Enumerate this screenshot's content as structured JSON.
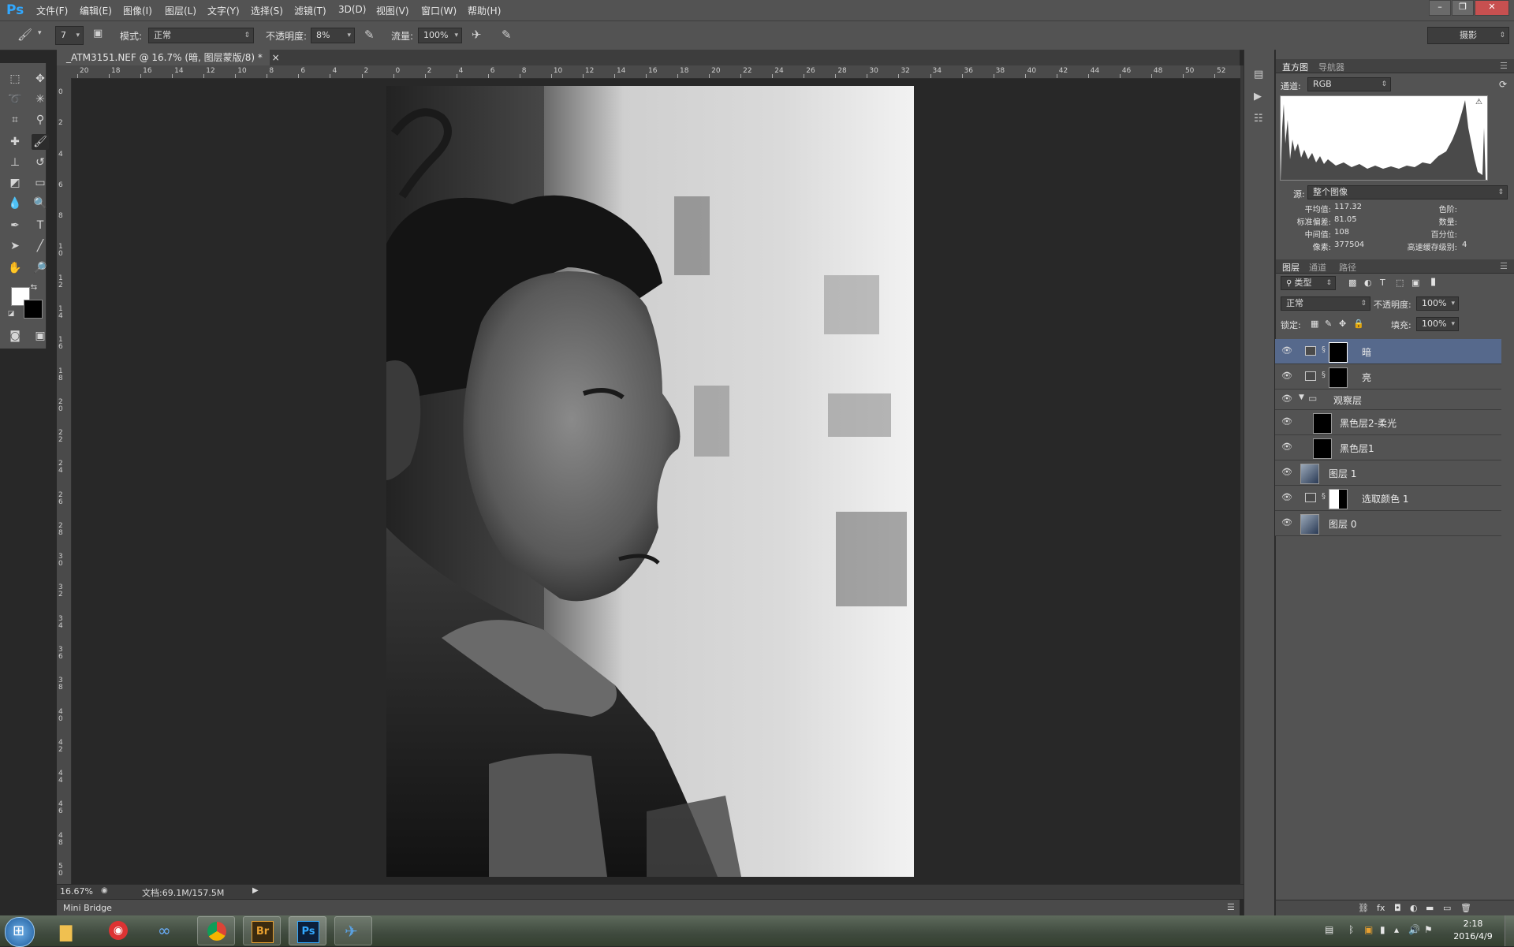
{
  "app": {
    "logo": "Ps"
  },
  "menu": [
    "文件(F)",
    "编辑(E)",
    "图像(I)",
    "图层(L)",
    "文字(Y)",
    "选择(S)",
    "滤镜(T)",
    "3D(D)",
    "视图(V)",
    "窗口(W)",
    "帮助(H)"
  ],
  "window_controls": {
    "minimize": "–",
    "restore": "❐",
    "close": "✕"
  },
  "options": {
    "brush_size": "7",
    "mode_label": "模式:",
    "mode_value": "正常",
    "opacity_label": "不透明度:",
    "opacity_value": "8%",
    "flow_label": "流量:",
    "flow_value": "100%",
    "workspace": "摄影"
  },
  "document": {
    "tab_title": "_ATM3151.NEF @ 16.7% (暗, 图层蒙版/8) *",
    "tab_close": "×",
    "zoom": "16.67%",
    "doc_size": "文档:69.1M/157.5M",
    "mini_bridge": "Mini Bridge",
    "h_ruler_ticks": [
      "20",
      "18",
      "16",
      "14",
      "12",
      "10",
      "8",
      "6",
      "4",
      "2",
      "0",
      "2",
      "4",
      "6",
      "8",
      "10",
      "12",
      "14",
      "16",
      "18",
      "20",
      "22",
      "24",
      "26",
      "28",
      "30",
      "32",
      "34",
      "36",
      "38",
      "40",
      "42",
      "44",
      "46",
      "48",
      "50",
      "52"
    ],
    "v_ruler_ticks": [
      "0",
      "2",
      "4",
      "6",
      "8",
      "10",
      "12",
      "14",
      "16",
      "18",
      "20",
      "22",
      "24",
      "26",
      "28",
      "30",
      "32",
      "34",
      "36",
      "38",
      "40",
      "42",
      "44",
      "46",
      "48",
      "50"
    ]
  },
  "histogram": {
    "tabs": [
      "直方图",
      "导航器"
    ],
    "channel_label": "通道:",
    "channel_value": "RGB",
    "source_label": "源:",
    "source_value": "整个图像",
    "stats": {
      "mean_label": "平均值:",
      "mean_value": "117.32",
      "stddev_label": "标准偏差:",
      "stddev_value": "81.05",
      "median_label": "中间值:",
      "median_value": "108",
      "pixels_label": "像素:",
      "pixels_value": "377504",
      "level_label": "色阶:",
      "count_label": "数量:",
      "percentile_label": "百分位:",
      "cache_label": "高速缓存级别:",
      "cache_value": "4"
    }
  },
  "layers_panel": {
    "tabs": [
      "图层",
      "通道",
      "路径"
    ],
    "filter_value": "类型",
    "blend_mode": "正常",
    "opacity_label": "不透明度:",
    "opacity_value": "100%",
    "lock_label": "锁定:",
    "fill_label": "填充:",
    "fill_value": "100%",
    "layers": [
      {
        "name": "暗",
        "kind": "curves-mask",
        "selected": true
      },
      {
        "name": "亮",
        "kind": "curves-mask",
        "selected": false
      },
      {
        "name": "观察层",
        "kind": "group",
        "selected": false
      },
      {
        "name": "黑色层2-柔光",
        "kind": "fill",
        "selected": false
      },
      {
        "name": "黑色层1",
        "kind": "fill",
        "selected": false
      },
      {
        "name": "图层 1",
        "kind": "photo",
        "selected": false
      },
      {
        "name": "选取颜色 1",
        "kind": "selective-color-mask",
        "selected": false
      },
      {
        "name": "图层 0",
        "kind": "photo",
        "selected": false
      }
    ]
  },
  "taskbar": {
    "time": "2:18",
    "date": "2016/4/9",
    "apps": [
      "start",
      "explorer",
      "netease-music",
      "infinity",
      "chrome",
      "bridge",
      "photoshop",
      "app"
    ],
    "bridge_label": "Br",
    "ps_label": "Ps"
  }
}
